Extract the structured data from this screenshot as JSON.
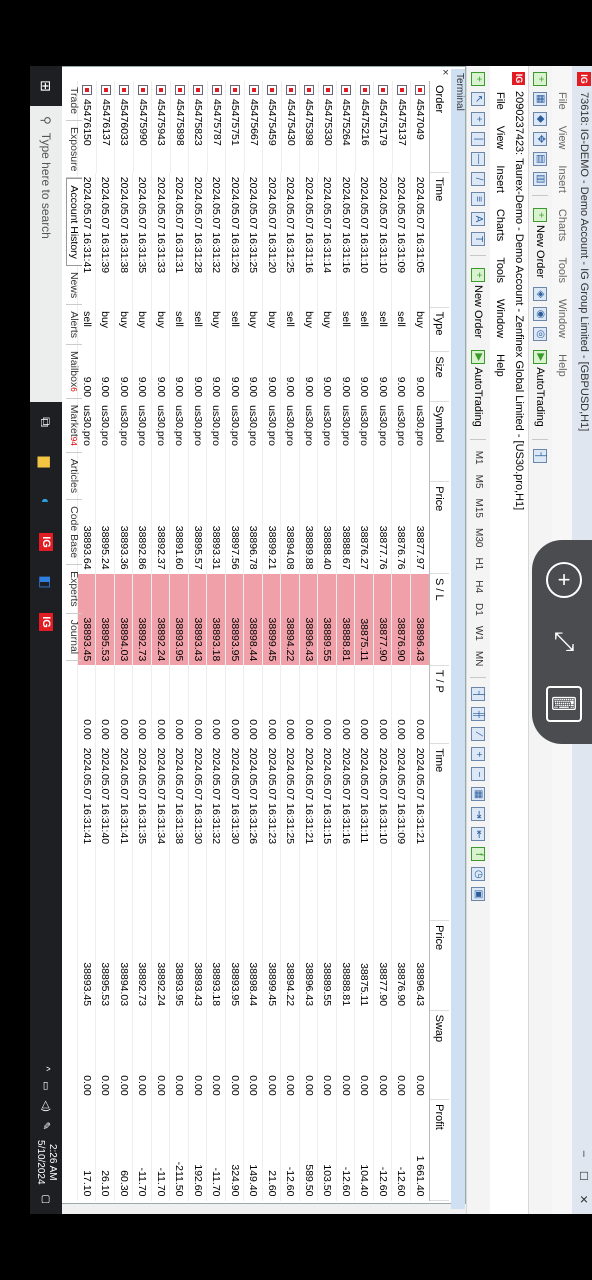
{
  "window": {
    "title": "73618: IG-DEMO - Demo Account - IG Group Limited - [GBPUSD,H1]",
    "logo": "IG",
    "controls": [
      "–",
      "☐",
      "✕"
    ]
  },
  "menu1": [
    "File",
    "View",
    "Insert",
    "Charts",
    "Tools",
    "Window",
    "Help"
  ],
  "toolbar1": {
    "new_order": "New Order",
    "autotrading": "AutoTrading"
  },
  "subwindow": {
    "title": "2090237423: Taurex-Demo - Demo Account - Zenfinex Global Limited - [US30.pro,H1]",
    "menu": [
      "File",
      "View",
      "Insert",
      "Charts",
      "Tools",
      "Window",
      "Help"
    ],
    "new_order": "New Order",
    "autotrading": "AutoTrading",
    "timeframes": [
      "M1",
      "M5",
      "M15",
      "M30",
      "H1",
      "H4",
      "D1",
      "W1",
      "MN"
    ]
  },
  "terminal": {
    "label": "Terminal",
    "columns": [
      "Order",
      "Time",
      "Type",
      "Size",
      "Symbol",
      "Price",
      "S / L",
      "T / P",
      "Time",
      "Price",
      "Swap",
      "Profit"
    ],
    "rows": [
      [
        "4547049",
        "2024.05.07 16:31:05",
        "buy",
        "9.00",
        "us30.pro",
        "38877.97",
        "38896.43",
        "0.00",
        "2024.05.07 16:31:21",
        "38896.43",
        "0.00",
        "1 661.40"
      ],
      [
        "45475137",
        "2024.05.07 16:31:09",
        "sell",
        "9.00",
        "us30.pro",
        "38876.76",
        "38876.90",
        "0.00",
        "2024.05.07 16:31:09",
        "38876.90",
        "0.00",
        "-12.60"
      ],
      [
        "45475179",
        "2024.05.07 16:31:10",
        "sell",
        "9.00",
        "us30.pro",
        "38877.76",
        "38877.90",
        "0.00",
        "2024.05.07 16:31:10",
        "38877.90",
        "0.00",
        "-12.60"
      ],
      [
        "45475216",
        "2024.05.07 16:31:10",
        "sell",
        "9.00",
        "us30.pro",
        "38876.27",
        "38875.11",
        "0.00",
        "2024.05.07 16:31:11",
        "38875.11",
        "0.00",
        "104.40"
      ],
      [
        "45475264",
        "2024.05.07 16:31:16",
        "sell",
        "9.00",
        "us30.pro",
        "38888.67",
        "38888.81",
        "0.00",
        "2024.05.07 16:31:16",
        "38888.81",
        "0.00",
        "-12.60"
      ],
      [
        "45475330",
        "2024.05.07 16:31:14",
        "buy",
        "9.00",
        "us30.pro",
        "38888.40",
        "38889.55",
        "0.00",
        "2024.05.07 16:31:15",
        "38889.55",
        "0.00",
        "103.50"
      ],
      [
        "45475398",
        "2024.05.07 16:31:16",
        "buy",
        "9.00",
        "us30.pro",
        "38889.88",
        "38896.43",
        "0.00",
        "2024.05.07 16:31:21",
        "38896.43",
        "0.00",
        "589.50"
      ],
      [
        "45475430",
        "2024.05.07 16:31:25",
        "sell",
        "9.00",
        "us30.pro",
        "38894.08",
        "38894.22",
        "0.00",
        "2024.05.07 16:31:25",
        "38894.22",
        "0.00",
        "-12.60"
      ],
      [
        "45475459",
        "2024.05.07 16:31:20",
        "buy",
        "9.00",
        "us30.pro",
        "38899.21",
        "38899.45",
        "0.00",
        "2024.05.07 16:31:23",
        "38899.45",
        "0.00",
        "21.60"
      ],
      [
        "45475667",
        "2024.05.07 16:31:25",
        "buy",
        "9.00",
        "us30.pro",
        "38896.78",
        "38898.44",
        "0.00",
        "2024.05.07 16:31:26",
        "38898.44",
        "0.00",
        "149.40"
      ],
      [
        "45475751",
        "2024.05.07 16:31:26",
        "sell",
        "9.00",
        "us30.pro",
        "38897.56",
        "38893.95",
        "0.00",
        "2024.05.07 16:31:30",
        "38893.95",
        "0.00",
        "324.90"
      ],
      [
        "45475787",
        "2024.05.07 16:31:32",
        "buy",
        "9.00",
        "us30.pro",
        "38893.31",
        "38893.18",
        "0.00",
        "2024.05.07 16:31:32",
        "38893.18",
        "0.00",
        "-11.70"
      ],
      [
        "45475823",
        "2024.05.07 16:31:28",
        "sell",
        "9.00",
        "us30.pro",
        "38895.57",
        "38893.43",
        "0.00",
        "2024.05.07 16:31:30",
        "38893.43",
        "0.00",
        "192.60"
      ],
      [
        "45475898",
        "2024.05.07 16:31:31",
        "sell",
        "9.00",
        "us30.pro",
        "38891.60",
        "38893.95",
        "0.00",
        "2024.05.07 16:31:38",
        "38893.95",
        "0.00",
        "-211.50"
      ],
      [
        "45475943",
        "2024.05.07 16:31:33",
        "buy",
        "9.00",
        "us30.pro",
        "38892.37",
        "38892.24",
        "0.00",
        "2024.05.07 16:31:34",
        "38892.24",
        "0.00",
        "-11.70"
      ],
      [
        "45475990",
        "2024.05.07 16:31:35",
        "buy",
        "9.00",
        "us30.pro",
        "38892.86",
        "38892.73",
        "0.00",
        "2024.05.07 16:31:35",
        "38892.73",
        "0.00",
        "-11.70"
      ],
      [
        "45476033",
        "2024.05.07 16:31:38",
        "buy",
        "9.00",
        "us30.pro",
        "38893.36",
        "38894.03",
        "0.00",
        "2024.05.07 16:31:41",
        "38894.03",
        "0.00",
        "60.30"
      ],
      [
        "45476137",
        "2024.05.07 16:31:39",
        "buy",
        "9.00",
        "us30.pro",
        "38895.24",
        "38895.53",
        "0.00",
        "2024.05.07 16:31:40",
        "38895.53",
        "0.00",
        "26.10"
      ],
      [
        "45476150",
        "2024.05.07 16:31:41",
        "sell",
        "9.00",
        "us30.pro",
        "38893.64",
        "38893.45",
        "0.00",
        "2024.05.07 16:31:41",
        "38893.45",
        "0.00",
        "17.10"
      ]
    ],
    "tabs": [
      {
        "label": "Trade",
        "badge": ""
      },
      {
        "label": "Exposure",
        "badge": ""
      },
      {
        "label": "Account History",
        "badge": ""
      },
      {
        "label": "News",
        "badge": ""
      },
      {
        "label": "Alerts",
        "badge": ""
      },
      {
        "label": "Mailbox",
        "badge": "6"
      },
      {
        "label": "Market",
        "badge": "94"
      },
      {
        "label": "Articles",
        "badge": ""
      },
      {
        "label": "Code Base",
        "badge": ""
      },
      {
        "label": "Experts",
        "badge": ""
      },
      {
        "label": "Journal",
        "badge": ""
      }
    ],
    "active_tab": "Account History",
    "sl_highlight_color": "#f0a0a8"
  },
  "taskbar": {
    "search_placeholder": "Type here to search",
    "time": "2:26 AM",
    "date": "5/10/2024",
    "apps": [
      "IG"
    ]
  }
}
